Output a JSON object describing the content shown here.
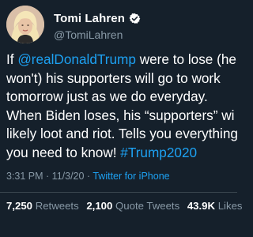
{
  "profile": {
    "display_name": "Tomi Lahren",
    "handle": "@TomiLahren",
    "verified_icon": "verified-badge-icon",
    "avatar_icon": "avatar-photo"
  },
  "tweet": {
    "lines": [
      [
        "If ",
        "@realDonaldTrump",
        " were to lose (he"
      ],
      [
        "won't) his supporters will go to work",
        "",
        ""
      ],
      [
        "tomorrow just as we do everyday.",
        "",
        ""
      ],
      [
        "When Biden loses, his “supporters” wi",
        "",
        ""
      ],
      [
        "likely loot and riot. Tells you everything",
        "",
        ""
      ],
      [
        "you need to know! ",
        "#Trump2020",
        ""
      ]
    ]
  },
  "meta": {
    "time": "3:31 PM",
    "separator": " · ",
    "date": "11/3/20",
    "separator2": " · ",
    "source": "Twitter for iPhone"
  },
  "stats": {
    "retweets_count": "7,250",
    "retweets_label": "Retweets",
    "quotes_count": "2,100",
    "quotes_label": "Quote Tweets",
    "likes_count": "43.9K",
    "likes_label": "Likes"
  },
  "colors": {
    "background": "#15202b",
    "link": "#1da1f2",
    "secondary_text": "#8899a6",
    "divider": "#38444d"
  }
}
